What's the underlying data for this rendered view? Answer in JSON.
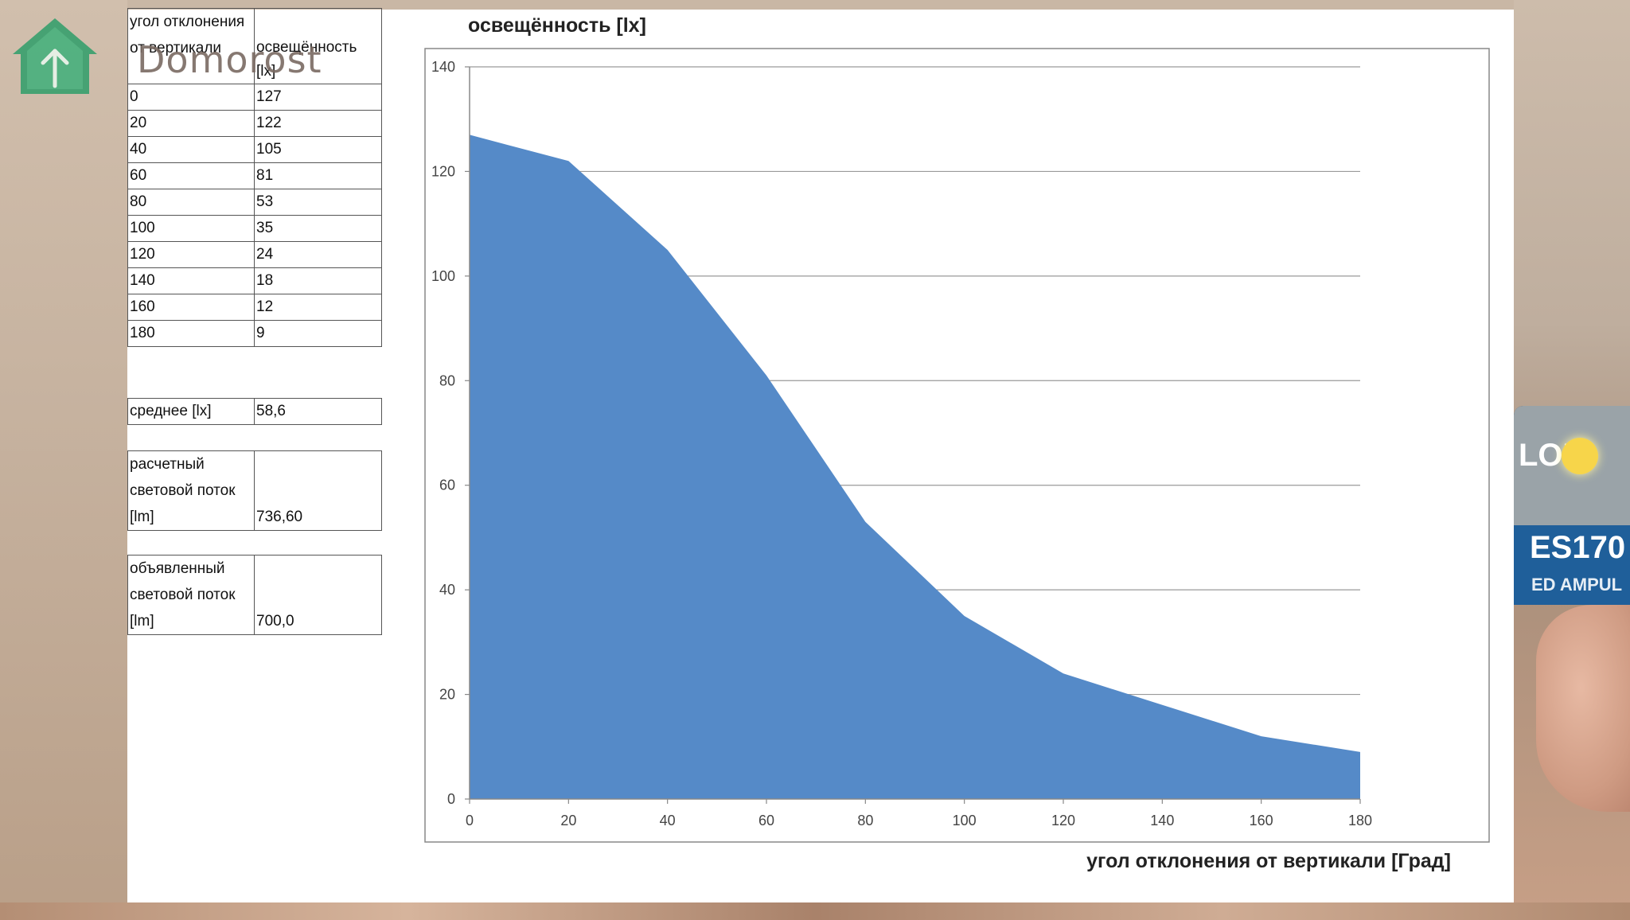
{
  "overlay": {
    "brand": "Domorost",
    "logo_icon": "house-up-arrow-icon"
  },
  "background_package": {
    "text1": "LOB",
    "text2": "ES170",
    "text3": "ED AMPUL"
  },
  "table": {
    "header": {
      "col1": "угол отклонения от вертикали",
      "col2": "освещённость [lx]"
    },
    "rows": [
      [
        "0",
        "127"
      ],
      [
        "20",
        "122"
      ],
      [
        "40",
        "105"
      ],
      [
        "60",
        "81"
      ],
      [
        "80",
        "53"
      ],
      [
        "100",
        "35"
      ],
      [
        "120",
        "24"
      ],
      [
        "140",
        "18"
      ],
      [
        "160",
        "12"
      ],
      [
        "180",
        "9"
      ]
    ]
  },
  "summary": {
    "average": {
      "label": "среднее  [lx]",
      "value": "58,6"
    },
    "calculated": {
      "label": "расчетный световой поток  [lm]",
      "value": "736,60"
    },
    "declared": {
      "label": "объявленный световой поток  [lm]",
      "value": "700,0"
    }
  },
  "chart_data": {
    "type": "area",
    "title": "освещённость [lx]",
    "xlabel": "угол отклонения от вертикали  [Град]",
    "ylabel": "",
    "x": [
      0,
      20,
      40,
      60,
      80,
      100,
      120,
      140,
      160,
      180
    ],
    "series": [
      {
        "values": [
          127,
          122,
          105,
          81,
          53,
          35,
          24,
          18,
          12,
          9
        ],
        "color": "#558ac8"
      }
    ],
    "xlim": [
      0,
      180
    ],
    "ylim": [
      0,
      140
    ],
    "xticks": [
      0,
      20,
      40,
      60,
      80,
      100,
      120,
      140,
      160,
      180
    ],
    "yticks": [
      0,
      20,
      40,
      60,
      80,
      100,
      120,
      140
    ],
    "grid": "horizontal",
    "legend": "none"
  }
}
